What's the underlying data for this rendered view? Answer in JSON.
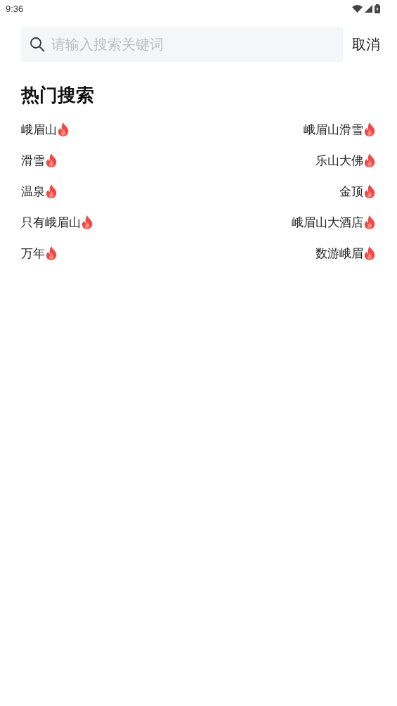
{
  "status_bar": {
    "time": "9:36"
  },
  "search": {
    "placeholder": "请输入搜索关键词",
    "cancel": "取消"
  },
  "hot_searches": {
    "title": "热门搜索",
    "items": [
      {
        "label": "峨眉山"
      },
      {
        "label": "峨眉山滑雪"
      },
      {
        "label": "滑雪"
      },
      {
        "label": "乐山大佛"
      },
      {
        "label": "温泉"
      },
      {
        "label": "金顶"
      },
      {
        "label": "只有峨眉山"
      },
      {
        "label": "峨眉山大酒店"
      },
      {
        "label": "万年"
      },
      {
        "label": "数游峨眉"
      }
    ]
  }
}
